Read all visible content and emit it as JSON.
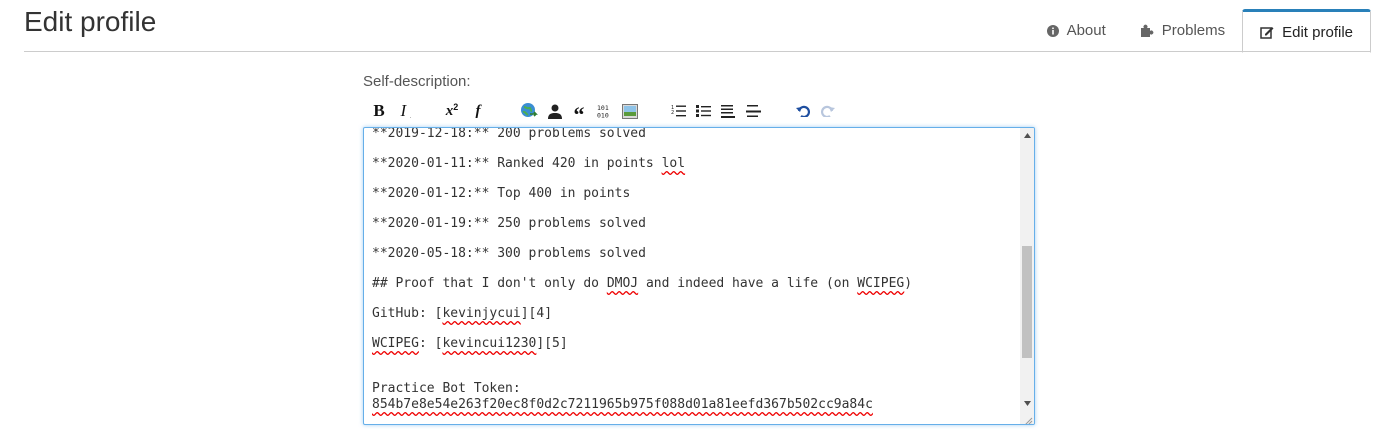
{
  "page_title": "Edit profile",
  "tabs": [
    {
      "label": "About",
      "icon": "info-circle-icon"
    },
    {
      "label": "Problems",
      "icon": "puzzle-icon"
    },
    {
      "label": "Edit profile",
      "icon": "edit-icon"
    }
  ],
  "active_tab": "Edit profile",
  "accent_color": "#2980b9",
  "form": {
    "self_description_label": "Self-description:"
  },
  "toolbar_icons": [
    "bold-icon",
    "italic-icon",
    "superscript-icon",
    "function-icon",
    "link-icon",
    "user-icon",
    "quote-icon",
    "code-icon",
    "image-icon",
    "ordered-list-icon",
    "unordered-list-icon",
    "heading-icon",
    "horizontal-rule-icon",
    "undo-icon",
    "redo-icon"
  ],
  "editor": {
    "lines": [
      "**2019-12-18:** 200 problems solved",
      "**2020-01-11:** Ranked 420 in points ",
      "lol",
      "**2020-01-12:** Top 400 in points",
      "**2020-01-19:** 250 problems solved",
      "**2020-05-18:** 300 problems solved",
      "## Proof that I don't only do ",
      "DMOJ",
      " and indeed have a life (on ",
      "WCIPEG",
      ")",
      "GitHub: [",
      "kevinjycui",
      "][4]",
      "WCIPEG",
      ": [",
      "kevincui1230",
      "][5]",
      "Practice Bot Token:",
      "854b7e8e54e263f20ec8f0d2c7211965b975f088d01a81eefd367b502cc9a84c"
    ]
  }
}
